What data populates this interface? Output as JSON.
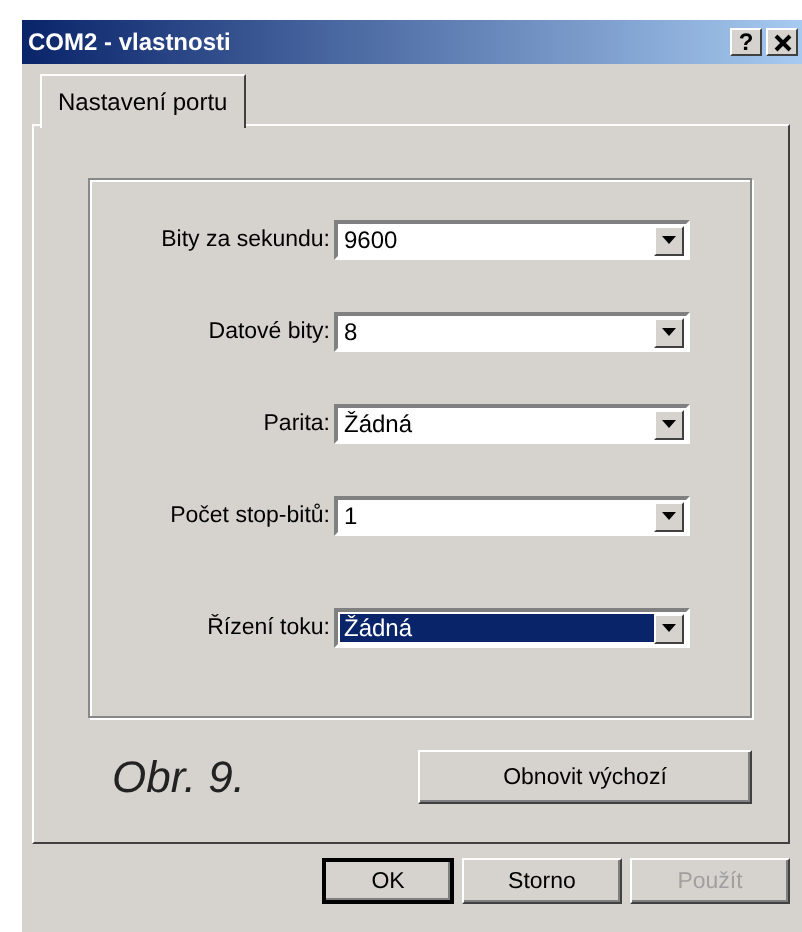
{
  "window": {
    "title": "COM2 - vlastnosti",
    "help_button": "?"
  },
  "tabs": [
    {
      "label": "Nastavení portu",
      "selected": true
    }
  ],
  "fields": [
    {
      "label": "Bity za sekundu:",
      "value": "9600",
      "focused": false
    },
    {
      "label": "Datové bity:",
      "value": "8",
      "focused": false
    },
    {
      "label": "Parita:",
      "value": "Žádná",
      "focused": false
    },
    {
      "label": "Počet stop-bitů:",
      "value": "1",
      "focused": false
    },
    {
      "label": "Řízení toku:",
      "value": "Žádná",
      "focused": true
    }
  ],
  "caption": "Obr. 9.",
  "restore_button": "Obnovit výchozí",
  "buttons": [
    {
      "label": "OK",
      "default": true,
      "disabled": false
    },
    {
      "label": "Storno",
      "default": false,
      "disabled": false
    },
    {
      "label": "Použít",
      "default": false,
      "disabled": true
    }
  ]
}
